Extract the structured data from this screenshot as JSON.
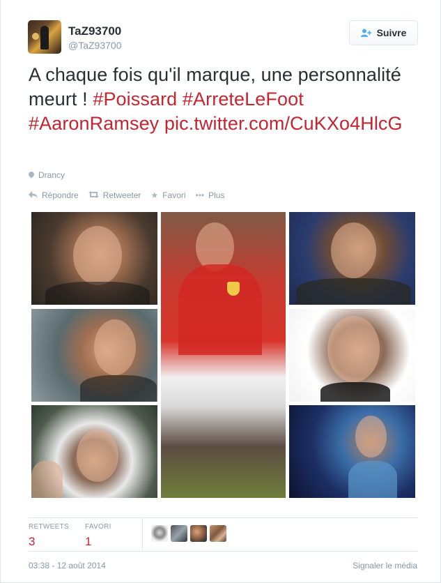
{
  "user": {
    "fullname": "TaZ93700",
    "username": "@TaZ93700"
  },
  "follow_button": {
    "label": "Suivre",
    "icon": "follow-user-icon"
  },
  "tweet": {
    "text_plain_1": "A chaque fois qu'il marque, une personnalité meurt ! ",
    "hashtags": [
      "#Poissard",
      "#ArreteLeFoot",
      "#AaronRamsey"
    ],
    "link": "pic.twitter.com/CuKXo4HlcG"
  },
  "location": {
    "label": "Drancy",
    "icon": "location-pin-icon"
  },
  "actions": [
    {
      "label": "Répondre",
      "icon": "reply-icon"
    },
    {
      "label": "Retweeter",
      "icon": "retweet-icon"
    },
    {
      "label": "Favori",
      "icon": "star-icon"
    },
    {
      "label": "Plus",
      "icon": "more-dots-icon"
    }
  ],
  "stats": {
    "retweets": {
      "label": "RETWEETS",
      "value": "3"
    },
    "favorites": {
      "label": "FAVORI",
      "value": "1"
    }
  },
  "footer": {
    "timestamp": "03:38 - 12 août 2014",
    "report": "Signaler le média"
  },
  "colors": {
    "accent": "#c6252f",
    "muted": "#8899a6",
    "follow_icon": "#55acee"
  }
}
